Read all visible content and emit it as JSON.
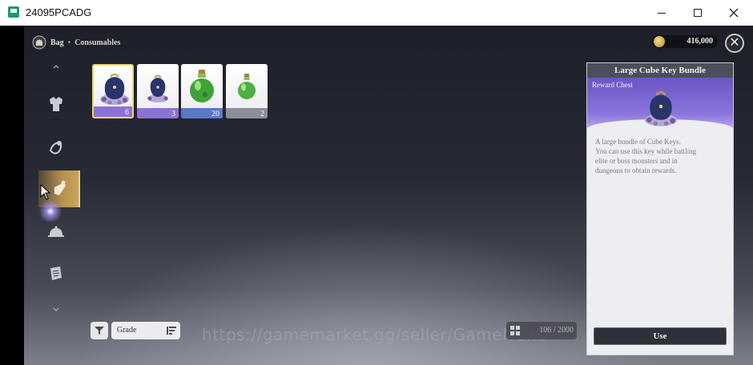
{
  "window": {
    "title": "24095PCADG",
    "minimize_icon": "minimize-icon",
    "maximize_icon": "maximize-icon",
    "close_icon": "close-icon"
  },
  "header": {
    "section": "Bag",
    "separator": "•",
    "subsection": "Consumables",
    "currency_value": "416,000",
    "currency_icon": "gold-coin-icon",
    "close_glyph": "✕"
  },
  "categories": [
    {
      "name": "chevron-up-icon"
    },
    {
      "name": "armor-icon"
    },
    {
      "name": "accessory-icon"
    },
    {
      "name": "consumable-potion-icon",
      "selected": true
    },
    {
      "name": "food-cloche-icon"
    },
    {
      "name": "scroll-icon"
    },
    {
      "name": "chevron-down-icon"
    }
  ],
  "items": [
    {
      "id": "large-cube-key-bundle",
      "icon": "key-bundle-large-icon",
      "count": "6",
      "grade_color": "#8d72d6",
      "selected": true
    },
    {
      "id": "cube-key-bundle",
      "icon": "key-bundle-icon",
      "count": "3",
      "grade_color": "#8d72d6",
      "selected": false
    },
    {
      "id": "green-potion-large",
      "icon": "green-potion-icon",
      "count": "20",
      "grade_color": "#5a78c8",
      "selected": false
    },
    {
      "id": "green-potion-small",
      "icon": "small-green-potion-icon",
      "count": "2",
      "grade_color": "#8c8e99",
      "selected": false
    }
  ],
  "controls": {
    "filter_icon": "filter-icon",
    "sort_label": "Grade",
    "sort_icon": "sort-icon",
    "capacity_icon": "grid-icon",
    "capacity": "106 / 2000"
  },
  "watermark": "https://gamemarket.gg/seller/GameNews",
  "detail": {
    "title": "Large Cube Key Bundle",
    "type": "Reward Chest",
    "art_icon": "key-bundle-large-icon",
    "description_lines": [
      "A large bundle of Cube Keys.",
      "You can use this key while battling",
      "elite or boss monsters and in",
      "dungeons to obtain rewards."
    ],
    "use_label": "Use"
  }
}
